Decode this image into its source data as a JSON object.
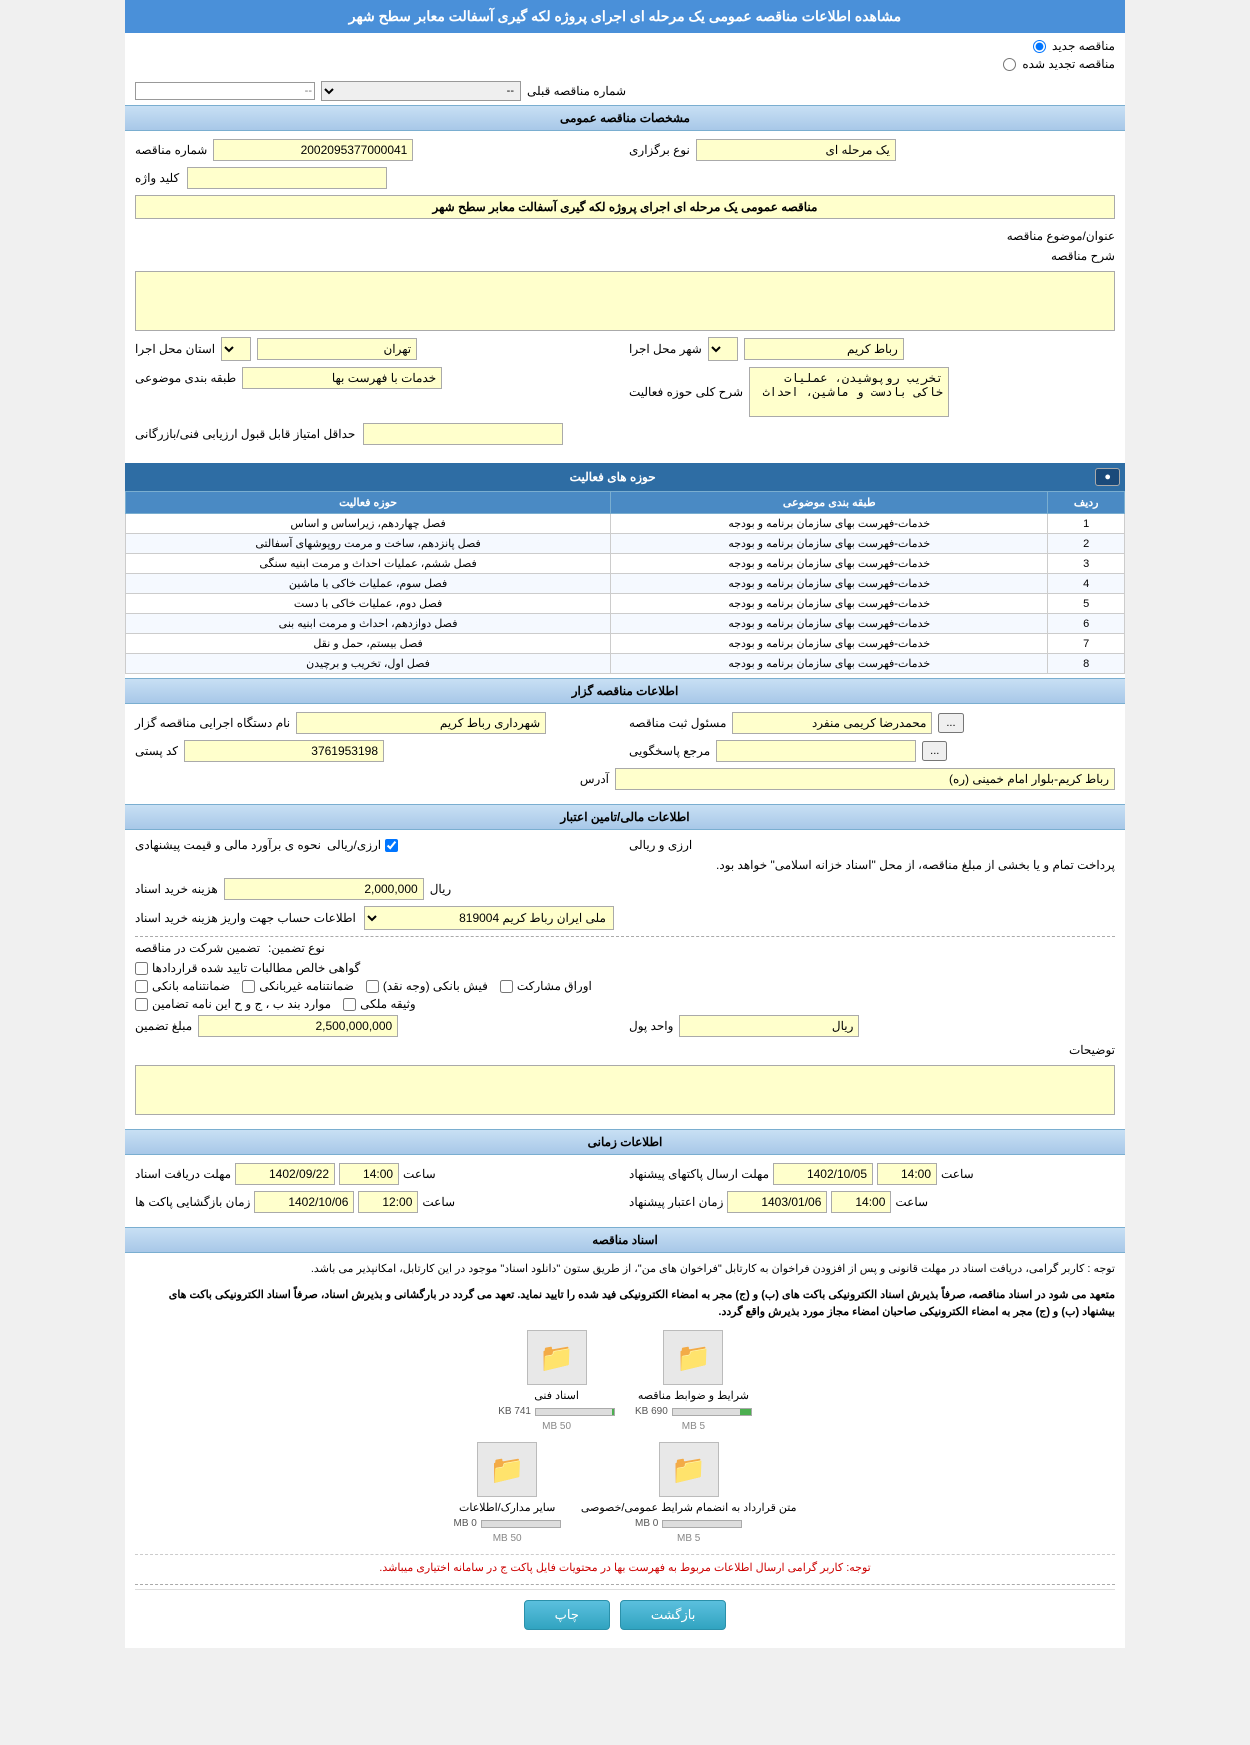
{
  "page": {
    "title": "مشاهده اطلاعات مناقصه عمومی یک مرحله ای اجرای پروژه لکه گیری آسفالت معابر سطح شهر",
    "radio_new": "مناقصه جدید",
    "radio_renewed": "مناقصه تجدید شده",
    "prev_label": "شماره مناقصه قبلی",
    "prev_placeholder": "--"
  },
  "general": {
    "section_title": "مشخصات مناقصه عمومی",
    "mofaghe_number_label": "شماره مناقصه",
    "mofaghe_number_value": "2002095377000041",
    "nooe_barggozari_label": "نوع برگزاری",
    "nooe_barggozari_value": "یک مرحله ای",
    "kelid_vazhe_label": "کلید واژه",
    "kelid_vazhe_value": "",
    "onvan_label": "عنوان/موضوع مناقصه",
    "onvan_value": "مناقصه عمومی یک مرحله ای اجرای پروژه لکه گیری آسفالت معابر سطح شهر",
    "sharh_label": "شرح مناقصه",
    "sharh_value": "",
    "ostan_label": "استان محل اجرا",
    "ostan_value": "تهران",
    "shahr_label": "شهر محل اجرا",
    "shahr_value": "رباط کریم",
    "tabaghe_label": "طبقه بندی موضوعی",
    "tabaghe_value": "خدمات با فهرست بها",
    "sharh_hoze_label": "شرح کلی حوزه فعالیت",
    "sharh_hoze_value": "تخریب روپوشیدن، عملیات خاکی بادست و ماشین، احداث",
    "hadaghal_label": "حداقل امتیاز قابل قبول ارزیابی فنی/بازرگانی",
    "hadaghal_value": ""
  },
  "activity_table": {
    "title": "حوزه های فعالیت",
    "add_btn": "●",
    "headers": [
      "ردیف",
      "طبقه بندی موضوعی",
      "حوزه فعالیت"
    ],
    "rows": [
      {
        "row": 1,
        "tabaghe": "خدمات-فهرست بهای سازمان برنامه و بودجه",
        "hoze": "فصل چهاردهم، زیراساس و اساس"
      },
      {
        "row": 2,
        "tabaghe": "خدمات-فهرست بهای سازمان برنامه و بودجه",
        "hoze": "فصل پانزدهم، ساخت و مرمت روپوشهای آسفالتی"
      },
      {
        "row": 3,
        "tabaghe": "خدمات-فهرست بهای سازمان برنامه و بودجه",
        "hoze": "فصل ششم، عملیات احداث و مرمت ابنیه سنگی"
      },
      {
        "row": 4,
        "tabaghe": "خدمات-فهرست بهای سازمان برنامه و بودجه",
        "hoze": "فصل سوم، عملیات خاکی با ماشین"
      },
      {
        "row": 5,
        "tabaghe": "خدمات-فهرست بهای سازمان برنامه و بودجه",
        "hoze": "فصل دوم، عملیات خاکی با دست"
      },
      {
        "row": 6,
        "tabaghe": "خدمات-فهرست بهای سازمان برنامه و بودجه",
        "hoze": "فصل دوازدهم، احداث و مرمت ابنیه بنی"
      },
      {
        "row": 7,
        "tabaghe": "خدمات-فهرست بهای سازمان برنامه و بودجه",
        "hoze": "فصل بیستم، حمل و نقل"
      },
      {
        "row": 8,
        "tabaghe": "خدمات-فهرست بهای سازمان برنامه و بودجه",
        "hoze": "فصل اول، تخریب و برچیدن"
      }
    ]
  },
  "executor": {
    "section_title": "اطلاعات مناقصه گزار",
    "name_label": "نام دستگاه اجرایی مناقصه گزار",
    "name_value": "شهرداری رباط کریم",
    "masool_label": "مسئول ثبت مناقصه",
    "masool_value": "محمدرضا کریمی منفرد",
    "masool_btn": "...",
    "marjae_label": "مرجع پاسخگویی",
    "marjae_value": "",
    "marjae_btn": "...",
    "kod_posti_label": "کد پستی",
    "kod_posti_value": "3761953198",
    "address_label": "آدرس",
    "address_value": "رباط کریم-بلوار امام خمینی (ره)"
  },
  "financial": {
    "section_title": "اطلاعات مالی/تامین اعتبار",
    "nahve_label": "نحوه ی برآورد مالی و قیمت پیشنهادی",
    "nahve_value": "ارزی/ریالی",
    "arzriali_text": "ارزی و ریالی",
    "payment_text": "پرداخت تمام و یا بخشی از مبلغ مناقصه، از محل \"اسناد خزانه اسلامی\" خواهد بود.",
    "hazeyne_label": "هزینه خرید اسناد",
    "hazeyne_value": "2,000,000",
    "hazeyne_unit": "ریال",
    "bank_info_label": "اطلاعات حساب جهت واریز هزینه خرید اسناد",
    "bank_info_value": "ملی ایران رباط کریم 819004",
    "guarantee_section": "تضمین شرکت در مناقصه",
    "nooe_tazmin_label": "نوع تضمین:",
    "tazmin_options": {
      "mohamanat_bank": "ضمانتنامه بانکی",
      "mohamanat_ghir": "ضمانتنامه غیربانکی",
      "mavarid": "موارد بند ب ، ج و ح این نامه تضامین",
      "fiche_bank": "فیش بانکی (وجه نقد)",
      "avarag": "اوراق مشارکت",
      "vathiqe": "وثیقه ملکی"
    },
    "govahi_text": "گواهی خالص مطالبات تایید شده قراردادها",
    "mablagh_label": "مبلغ تضمین",
    "mablagh_value": "2,500,000,000",
    "vahed_label": "واحد پول",
    "vahed_value": "ریال",
    "tozihat_label": "توضیحات",
    "tozihat_value": ""
  },
  "timing": {
    "section_title": "اطلاعات زمانی",
    "mohlat_daryaft_label": "مهلت دریافت اسناد",
    "mohlat_daryaft_date": "1402/09/22",
    "mohlat_daryaft_time": "14:00",
    "mohlat_ersal_label": "مهلت ارسال پاکتهای پیشنهاد",
    "mohlat_ersal_date": "1402/10/05",
    "mohlat_ersal_time": "14:00",
    "zaman_baz_label": "زمان بازگشایی پاکت ها",
    "zaman_baz_date": "1402/10/06",
    "zaman_baz_time": "12:00",
    "zaman_etebar_label": "زمان اعتبار پیشنهاد",
    "zaman_etebar_date": "1403/01/06",
    "zaman_etebar_time": "14:00",
    "saet_label": "ساعت"
  },
  "documents": {
    "section_title": "اسناد مناقصه",
    "notice1": "توجه : کاربر گرامی، دریافت اسناد در مهلت قانونی و پس از افزودن فراخوان به کارتابل \"فراخوان های من\"، از طریق ستون \"دانلود اسناد\" موجود در این کارتابل، امکانپذیر می باشد.",
    "notice2": "متعهد می شود در اسناد مناقصه، صرفاً بذیرش اسناد الکترونیکی باکت های (ب) و (ج) مجر به امضاء الکترونیکی فید شده را تایید نماید. تعهد می گردد در بارگشانی و بذیرش اسناد، صرفاً اسناد الکترونیکی باکت های بیشنهاد (ب) و (ج) مجر به امضاء الکترونیکی صاحبان امضاء مجاز مورد بذیرش واقع گردد.",
    "files": [
      {
        "label": "شرایط و ضوابط مناقصه",
        "size": "690 KB",
        "max": "5 MB",
        "progress": 14
      },
      {
        "label": "اسناد فنی",
        "size": "741 KB",
        "max": "50 MB",
        "progress": 2
      },
      {
        "label": "متن قرارداد به انضمام شرایط عمومی/خصوصی",
        "size": "0 MB",
        "max": "5 MB",
        "progress": 0
      },
      {
        "label": "سایر مدارک/اطلاعات",
        "size": "0 MB",
        "max": "50 MB",
        "progress": 0
      }
    ],
    "bottom_notice": "توجه: کاربر گرامی ارسال اطلاعات مربوط به فهرست بها در محتویات فایل پاکت ج در سامانه اختیاری میباشد.",
    "btn_print": "چاپ",
    "btn_back": "بازگشت"
  }
}
